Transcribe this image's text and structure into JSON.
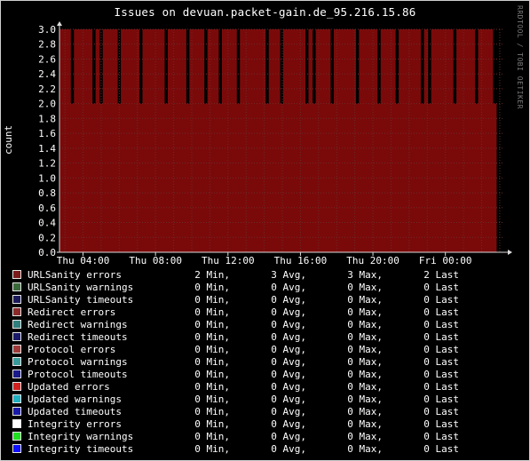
{
  "title": "Issues on devuan.packet-gain.de_95.216.15.86",
  "watermark": "RRDTOOL / TOBI OETIKER",
  "chart_data": {
    "type": "area",
    "ylabel": "count",
    "ylim": [
      0,
      3.0
    ],
    "yticks": [
      "0.0",
      "0.2",
      "0.4",
      "0.6",
      "0.8",
      "1.0",
      "1.2",
      "1.4",
      "1.6",
      "1.8",
      "2.0",
      "2.2",
      "2.4",
      "2.6",
      "2.8",
      "3.0"
    ],
    "xticks": [
      "Thu 04:00",
      "Thu 08:00",
      "Thu 12:00",
      "Thu 16:00",
      "Thu 20:00",
      "Fri 00:00"
    ],
    "grid": true,
    "series": [
      {
        "name": "URLSanity errors",
        "color": "#7a0a0a",
        "x_hours_start": 2.7,
        "x_hours_end": 26.8,
        "step_hours": 0.2,
        "values": [
          3,
          3,
          3,
          2,
          3,
          3,
          3,
          3,
          3,
          2,
          3,
          2,
          3,
          3,
          3,
          3,
          2,
          3,
          3,
          3,
          3,
          3,
          2,
          3,
          3,
          3,
          3,
          3,
          3,
          2,
          3,
          3,
          3,
          3,
          3,
          2,
          3,
          3,
          3,
          3,
          2,
          3,
          3,
          3,
          2,
          3,
          3,
          3,
          3,
          2,
          3,
          3,
          3,
          3,
          3,
          3,
          3,
          2,
          3,
          3,
          3,
          2,
          3,
          3,
          3,
          3,
          3,
          3,
          2,
          3,
          2,
          3,
          3,
          3,
          3,
          2,
          3,
          3,
          3,
          3,
          3,
          3,
          2,
          3,
          3,
          3,
          3,
          3,
          2,
          3,
          3,
          3,
          3,
          2,
          3,
          3,
          3,
          3,
          3,
          3,
          2,
          3,
          2,
          3,
          3,
          3,
          3,
          3,
          3,
          2,
          3,
          3,
          3,
          3,
          3,
          2,
          3,
          3,
          3,
          3,
          2
        ]
      }
    ],
    "x_hours_axis_start": 2.7,
    "x_hours_axis_end": 27.2
  },
  "legend": [
    {
      "name": "URLSanity errors",
      "color": "#7a1a1a",
      "min": "2 Min,",
      "avg": "3 Avg,",
      "max": "3 Max,",
      "last": "2 Last"
    },
    {
      "name": "URLSanity warnings",
      "color": "#3a6a3a",
      "min": "0 Min,",
      "avg": "0 Avg,",
      "max": "0 Max,",
      "last": "0 Last"
    },
    {
      "name": "URLSanity timeouts",
      "color": "#1a1a5a",
      "min": "0 Min,",
      "avg": "0 Avg,",
      "max": "0 Max,",
      "last": "0 Last"
    },
    {
      "name": "Redirect errors",
      "color": "#8a2a2a",
      "min": "0 Min,",
      "avg": "0 Avg,",
      "max": "0 Max,",
      "last": "0 Last"
    },
    {
      "name": "Redirect warnings",
      "color": "#2f7f7f",
      "min": "0 Min,",
      "avg": "0 Avg,",
      "max": "0 Max,",
      "last": "0 Last"
    },
    {
      "name": "Redirect timeouts",
      "color": "#1a1a6a",
      "min": "0 Min,",
      "avg": "0 Avg,",
      "max": "0 Max,",
      "last": "0 Last"
    },
    {
      "name": "Protocol errors",
      "color": "#a03a3a",
      "min": "0 Min,",
      "avg": "0 Avg,",
      "max": "0 Max,",
      "last": "0 Last"
    },
    {
      "name": "Protocol warnings",
      "color": "#3a9a9a",
      "min": "0 Min,",
      "avg": "0 Avg,",
      "max": "0 Max,",
      "last": "0 Last"
    },
    {
      "name": "Protocol timeouts",
      "color": "#1a1a8a",
      "min": "0 Min,",
      "avg": "0 Avg,",
      "max": "0 Max,",
      "last": "0 Last"
    },
    {
      "name": "Updated errors",
      "color": "#d02020",
      "min": "0 Min,",
      "avg": "0 Avg,",
      "max": "0 Max,",
      "last": "0 Last"
    },
    {
      "name": "Updated warnings",
      "color": "#20b0c0",
      "min": "0 Min,",
      "avg": "0 Avg,",
      "max": "0 Max,",
      "last": "0 Last"
    },
    {
      "name": "Updated timeouts",
      "color": "#1a1aa8",
      "min": "0 Min,",
      "avg": "0 Avg,",
      "max": "0 Max,",
      "last": "0 Last"
    },
    {
      "name": "Integrity errors",
      "color": "#ffffff",
      "min": "0 Min,",
      "avg": "0 Avg,",
      "max": "0 Max,",
      "last": "0 Last"
    },
    {
      "name": "Integrity warnings",
      "color": "#20e020",
      "min": "0 Min,",
      "avg": "0 Avg,",
      "max": "0 Max,",
      "last": "0 Last"
    },
    {
      "name": "Integrity timeouts",
      "color": "#1010ff",
      "min": "0 Min,",
      "avg": "0 Avg,",
      "max": "0 Max,",
      "last": "0 Last"
    }
  ]
}
